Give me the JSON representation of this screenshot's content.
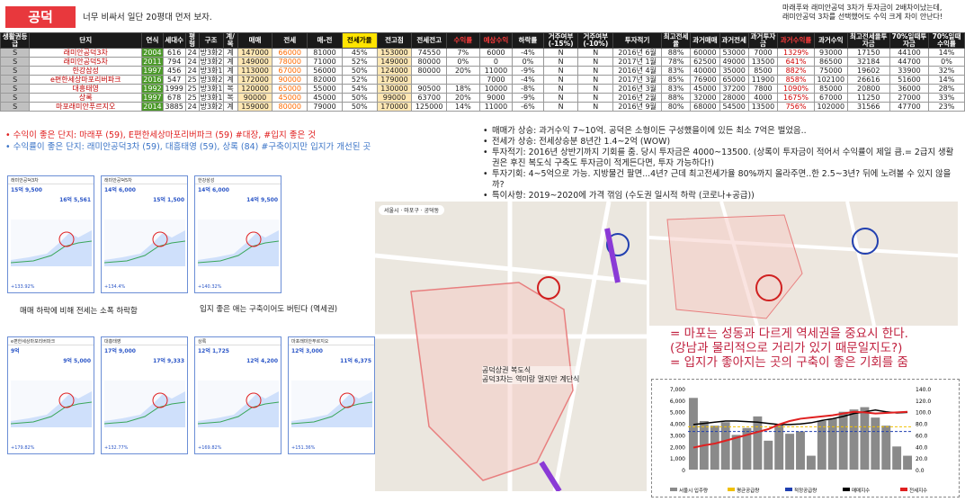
{
  "title": "공덕",
  "subtitle": "너무 비싸서 일단 20평대 먼저 보자.",
  "note_top_right": [
    "마래푸와 래미안공덕 3차가 투자금이 2배차이났는데,",
    "래미안공덕 3차를 선택했어도 수익 크게 차이 안난다!"
  ],
  "table": {
    "headers": [
      "생활권등급",
      "단지",
      "연식",
      "세대수",
      "평형",
      "구조",
      "계/복",
      "매매",
      "전세",
      "매-전",
      "전세가율",
      "전고점",
      "전세전고",
      "수익률",
      "예상수익",
      "하락률",
      "거주여부(-15%)",
      "거주여부(-10%)",
      "투자적기",
      "최고전세율",
      "과거매매",
      "과거전세",
      "과거투자금",
      "과거수익률",
      "과거수익",
      "최고전세율투자금",
      "70%일때투자금",
      "70%일때수익률"
    ],
    "rows": [
      [
        "S",
        "래미안공덕3차",
        "2004",
        "616",
        "24",
        "방3화2",
        "계",
        "147000",
        "66000",
        "81000",
        "45%",
        "153000",
        "74550",
        "7%",
        "6000",
        "-4%",
        "N",
        "N",
        "2016년 6월",
        "88%",
        "60000",
        "53000",
        "7000",
        "1329%",
        "93000",
        "17150",
        "44100",
        "14%"
      ],
      [
        "S",
        "래미안공덕5차",
        "2011",
        "794",
        "24",
        "방3화2",
        "계",
        "149000",
        "78000",
        "71000",
        "52%",
        "149000",
        "80000",
        "0%",
        "0",
        "0%",
        "N",
        "N",
        "2017년 1월",
        "78%",
        "62500",
        "49000",
        "13500",
        "641%",
        "86500",
        "32184",
        "44700",
        "0%"
      ],
      [
        "S",
        "한강삼성",
        "1997",
        "456",
        "24",
        "방3화1",
        "계",
        "113000",
        "67000",
        "56000",
        "50%",
        "124000",
        "80000",
        "20%",
        "11000",
        "-9%",
        "N",
        "N",
        "2016년 4월",
        "83%",
        "40000",
        "35000",
        "8500",
        "882%",
        "75000",
        "19602",
        "33900",
        "32%"
      ],
      [
        "S",
        "e편한세상마포리버파크",
        "2016",
        "547",
        "25",
        "방3화2",
        "계",
        "172000",
        "90000",
        "82000",
        "52%",
        "179000",
        "",
        "",
        "7000",
        "-4%",
        "N",
        "N",
        "2017년 3월",
        "85%",
        "76900",
        "65000",
        "11900",
        "858%",
        "102100",
        "26616",
        "51600",
        "14%"
      ],
      [
        "S",
        "대흥태영",
        "1992",
        "1999",
        "25",
        "방3화1",
        "복",
        "120000",
        "65000",
        "55000",
        "54%",
        "130000",
        "90500",
        "18%",
        "10000",
        "-8%",
        "N",
        "N",
        "2016년 3월",
        "83%",
        "45000",
        "37200",
        "7800",
        "1090%",
        "85000",
        "20800",
        "36000",
        "28%"
      ],
      [
        "S",
        "상록",
        "1997",
        "678",
        "25",
        "방3화1",
        "복",
        "90000",
        "45000",
        "45000",
        "50%",
        "99000",
        "63700",
        "20%",
        "9000",
        "-9%",
        "N",
        "N",
        "2016년 2월",
        "88%",
        "32000",
        "28000",
        "4000",
        "1675%",
        "67000",
        "11250",
        "27000",
        "33%"
      ],
      [
        "S",
        "마포래미안푸르지오",
        "2014",
        "3885",
        "24",
        "방3화2",
        "계",
        "159000",
        "80000",
        "79000",
        "50%",
        "170000",
        "125000",
        "14%",
        "11000",
        "-6%",
        "N",
        "N",
        "2016년 9월",
        "80%",
        "68000",
        "54500",
        "13500",
        "756%",
        "102000",
        "31566",
        "47700",
        "23%"
      ]
    ]
  },
  "left_bullets": [
    "수익이 좋은 단지: 마래푸 (59), E편한세상마포리버파크 (59) #대장, #입지 좋은 것",
    "수익률이 좋은 단지: 래미안공덕3차 (59), 대흥태영 (59), 상록 (84) #구축이지만 입지가 개선된 곳"
  ],
  "right_bullets": [
    "매매가 상승: 과거수익 7~10억. 공덕은 소형이든 구성했을이에 있든 최소 7억은 벌었음..",
    "전세가 상승: 전세상승분 8년간 1.4~2억 (WOW)",
    "투자적기: 2016년 상반기까지 기회를 줌. 당시 투자금은 4000~13500. (상록이 투자금이 적어서 수익률이 제일 큼.= 2급지 생활권은 후진 복도식 구축도 투자금이 적게든다면, 투자 가능하다!)",
    "투자기회: 4~5억으로 가능. 지방물건 팔면...4년? 근데 최고전세가율 80%까지 올라주면..한 2.5~3년? 뒤에 노려볼 수 있지 않을까?",
    "특이사항: 2019~2020에 가격 꺾임 (수도권 일시적 하락 (코로나+공급))"
  ],
  "phones": [
    {
      "title": "래미안공덕3차",
      "price": "15억 9,500",
      "price2": "16억 5,561",
      "foot": "+133.92%"
    },
    {
      "title": "래미안공덕5차",
      "price": "14억 6,000",
      "price2": "15억 1,500",
      "foot": "+134.4%"
    },
    {
      "title": "한강삼성",
      "price": "14억 6,000",
      "price2": "14억 9,500",
      "foot": "+140.32%"
    },
    {
      "title": "e편한세상마포리버파크",
      "price": "9억",
      "price2": "9억 5,000",
      "foot": "+179.82%"
    },
    {
      "title": "대흥태영",
      "price": "17억 9,000",
      "price2": "17억 9,333",
      "foot": "+132.77%"
    },
    {
      "title": "상록",
      "price": "12억 1,725",
      "price2": "12억 4,200",
      "foot": "+169.82%"
    },
    {
      "title": "마포래미안푸르지오",
      "price": "12억 3,000",
      "price2": "11억 6,375",
      "foot": "+151.36%"
    }
  ],
  "caption_left": "매매 하락에 비해 전세는 소폭 하락함",
  "caption_mid": "입지 좋은 애는 구축이어도 버틴다 (역세권)",
  "map_caption": [
    "공덕상권 복도식",
    "공덕3차는 역미랑 멀지만 계단식"
  ],
  "map_tabs": [
    "서울시",
    "마포구",
    "공덕동"
  ],
  "pink_lines": [
    "= 마포는 성동과 다르게 역세권을 중요시 한다.",
    "(강남과 물리적으로 거리가 있기 때문일지도?)",
    "= 입지가 좋아지는 곳의 구축이 좋은 기회를 줌"
  ],
  "combo_chart": {
    "type": "bar",
    "left_ticks": [
      "7,000",
      "6,000",
      "5,000",
      "4,000",
      "3,000",
      "2,000",
      "1,000",
      "0"
    ],
    "right_ticks": [
      "140.0",
      "120.0",
      "100.0",
      "80.0",
      "60.0",
      "40.0",
      "20.0",
      "0.0"
    ],
    "legend": [
      "서울시 입주량",
      "평균공급량",
      "적정공급량",
      "매매지수",
      "전세지수"
    ],
    "colors": {
      "bars": "#8a8a8a",
      "avg": "#f0c000",
      "adequate": "#1f3fb0",
      "sale": "#000000",
      "rent": "#e02020"
    },
    "bars": [
      6200,
      4200,
      3800,
      4100,
      3000,
      3600,
      4600,
      2500,
      3900,
      3100,
      3300,
      1200,
      4200,
      4400,
      5000,
      5200,
      5400,
      4500,
      3800,
      2000,
      1200
    ],
    "sale_index": [
      78,
      80,
      82,
      84,
      84,
      83,
      82,
      80,
      78,
      78,
      79,
      81,
      85,
      88,
      92,
      97,
      100,
      103,
      100,
      98,
      99
    ],
    "rent_index": [
      38,
      42,
      45,
      50,
      55,
      60,
      65,
      70,
      78,
      84,
      88,
      90,
      92,
      94,
      97,
      100,
      99,
      97,
      98,
      99,
      100
    ]
  }
}
